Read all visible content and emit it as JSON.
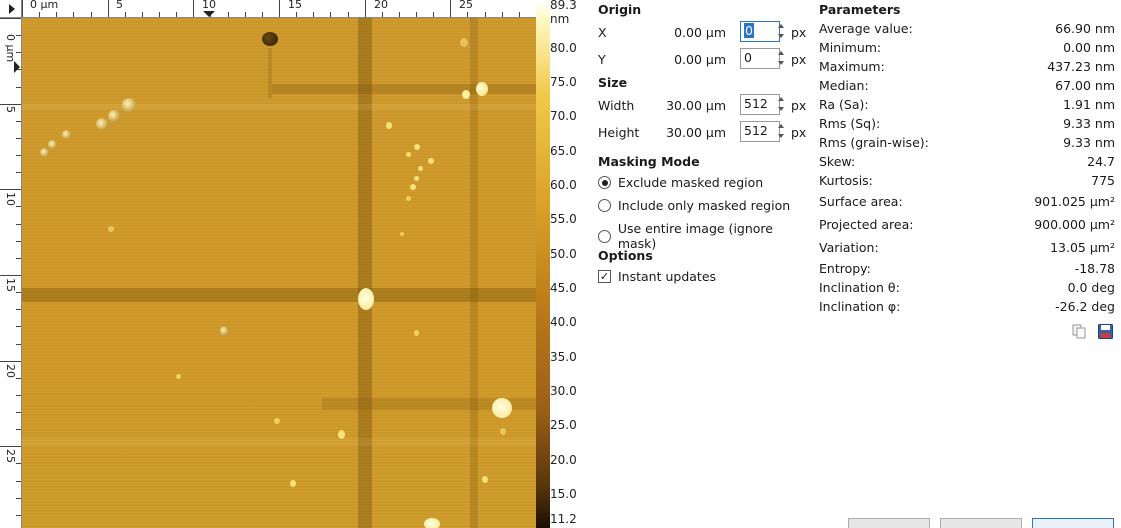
{
  "rulers": {
    "top_labels": [
      "0 µm",
      "5",
      "10",
      "15",
      "20",
      "25"
    ],
    "left_labels": [
      "0 µm",
      "5",
      "10",
      "15",
      "20",
      "25"
    ]
  },
  "color_scale": {
    "unit_label": "89.3 nm",
    "labels": [
      "80.0",
      "75.0",
      "70.0",
      "65.0",
      "60.0",
      "55.0",
      "50.0",
      "45.0",
      "40.0",
      "35.0",
      "30.0",
      "25.0",
      "20.0",
      "15.0",
      "11.2"
    ]
  },
  "origin": {
    "title": "Origin",
    "x_label": "X",
    "x_value": "0.00 µm",
    "x_px": "0",
    "y_label": "Y",
    "y_value": "0.00 µm",
    "y_px": "0",
    "unit": "px"
  },
  "size": {
    "title": "Size",
    "width_label": "Width",
    "width_value": "30.00 µm",
    "width_px": "512",
    "height_label": "Height",
    "height_value": "30.00 µm",
    "height_px": "512",
    "unit": "px"
  },
  "masking": {
    "title": "Masking Mode",
    "options": [
      "Exclude masked region",
      "Include only masked region",
      "Use entire image (ignore mask)"
    ],
    "selected": "Exclude masked region"
  },
  "options": {
    "title": "Options",
    "instant_updates_label": "Instant updates",
    "instant_updates_checked": true
  },
  "parameters": {
    "title": "Parameters",
    "rows": [
      {
        "label": "Average value:",
        "value": "66.90 nm"
      },
      {
        "label": "Minimum:",
        "value": "0.00 nm"
      },
      {
        "label": "Maximum:",
        "value": "437.23 nm"
      },
      {
        "label": "Median:",
        "value": "67.00 nm"
      },
      {
        "label": "Ra (Sa):",
        "value": "1.91 nm"
      },
      {
        "label": "Rms (Sq):",
        "value": "9.33 nm"
      },
      {
        "label": "Rms (grain-wise):",
        "value": "9.33 nm"
      },
      {
        "label": "Skew:",
        "value": "24.7"
      },
      {
        "label": "Kurtosis:",
        "value": "775"
      },
      {
        "label": "Surface area:",
        "value": "901.025 µm²"
      },
      {
        "label": "Projected area:",
        "value": "900.000 µm²"
      },
      {
        "label": "Variation:",
        "value": "13.05 µm²"
      },
      {
        "label": "Entropy:",
        "value": "-18.78"
      },
      {
        "label": "Inclination θ:",
        "value": "0.0 deg"
      },
      {
        "label": "Inclination φ:",
        "value": "-26.2 deg"
      }
    ]
  },
  "actions": {
    "copy_icon": "copy-icon",
    "save_icon": "save-icon"
  },
  "colors": {
    "selection": "#2b74c8",
    "topography_base": "#cf9a2c"
  }
}
